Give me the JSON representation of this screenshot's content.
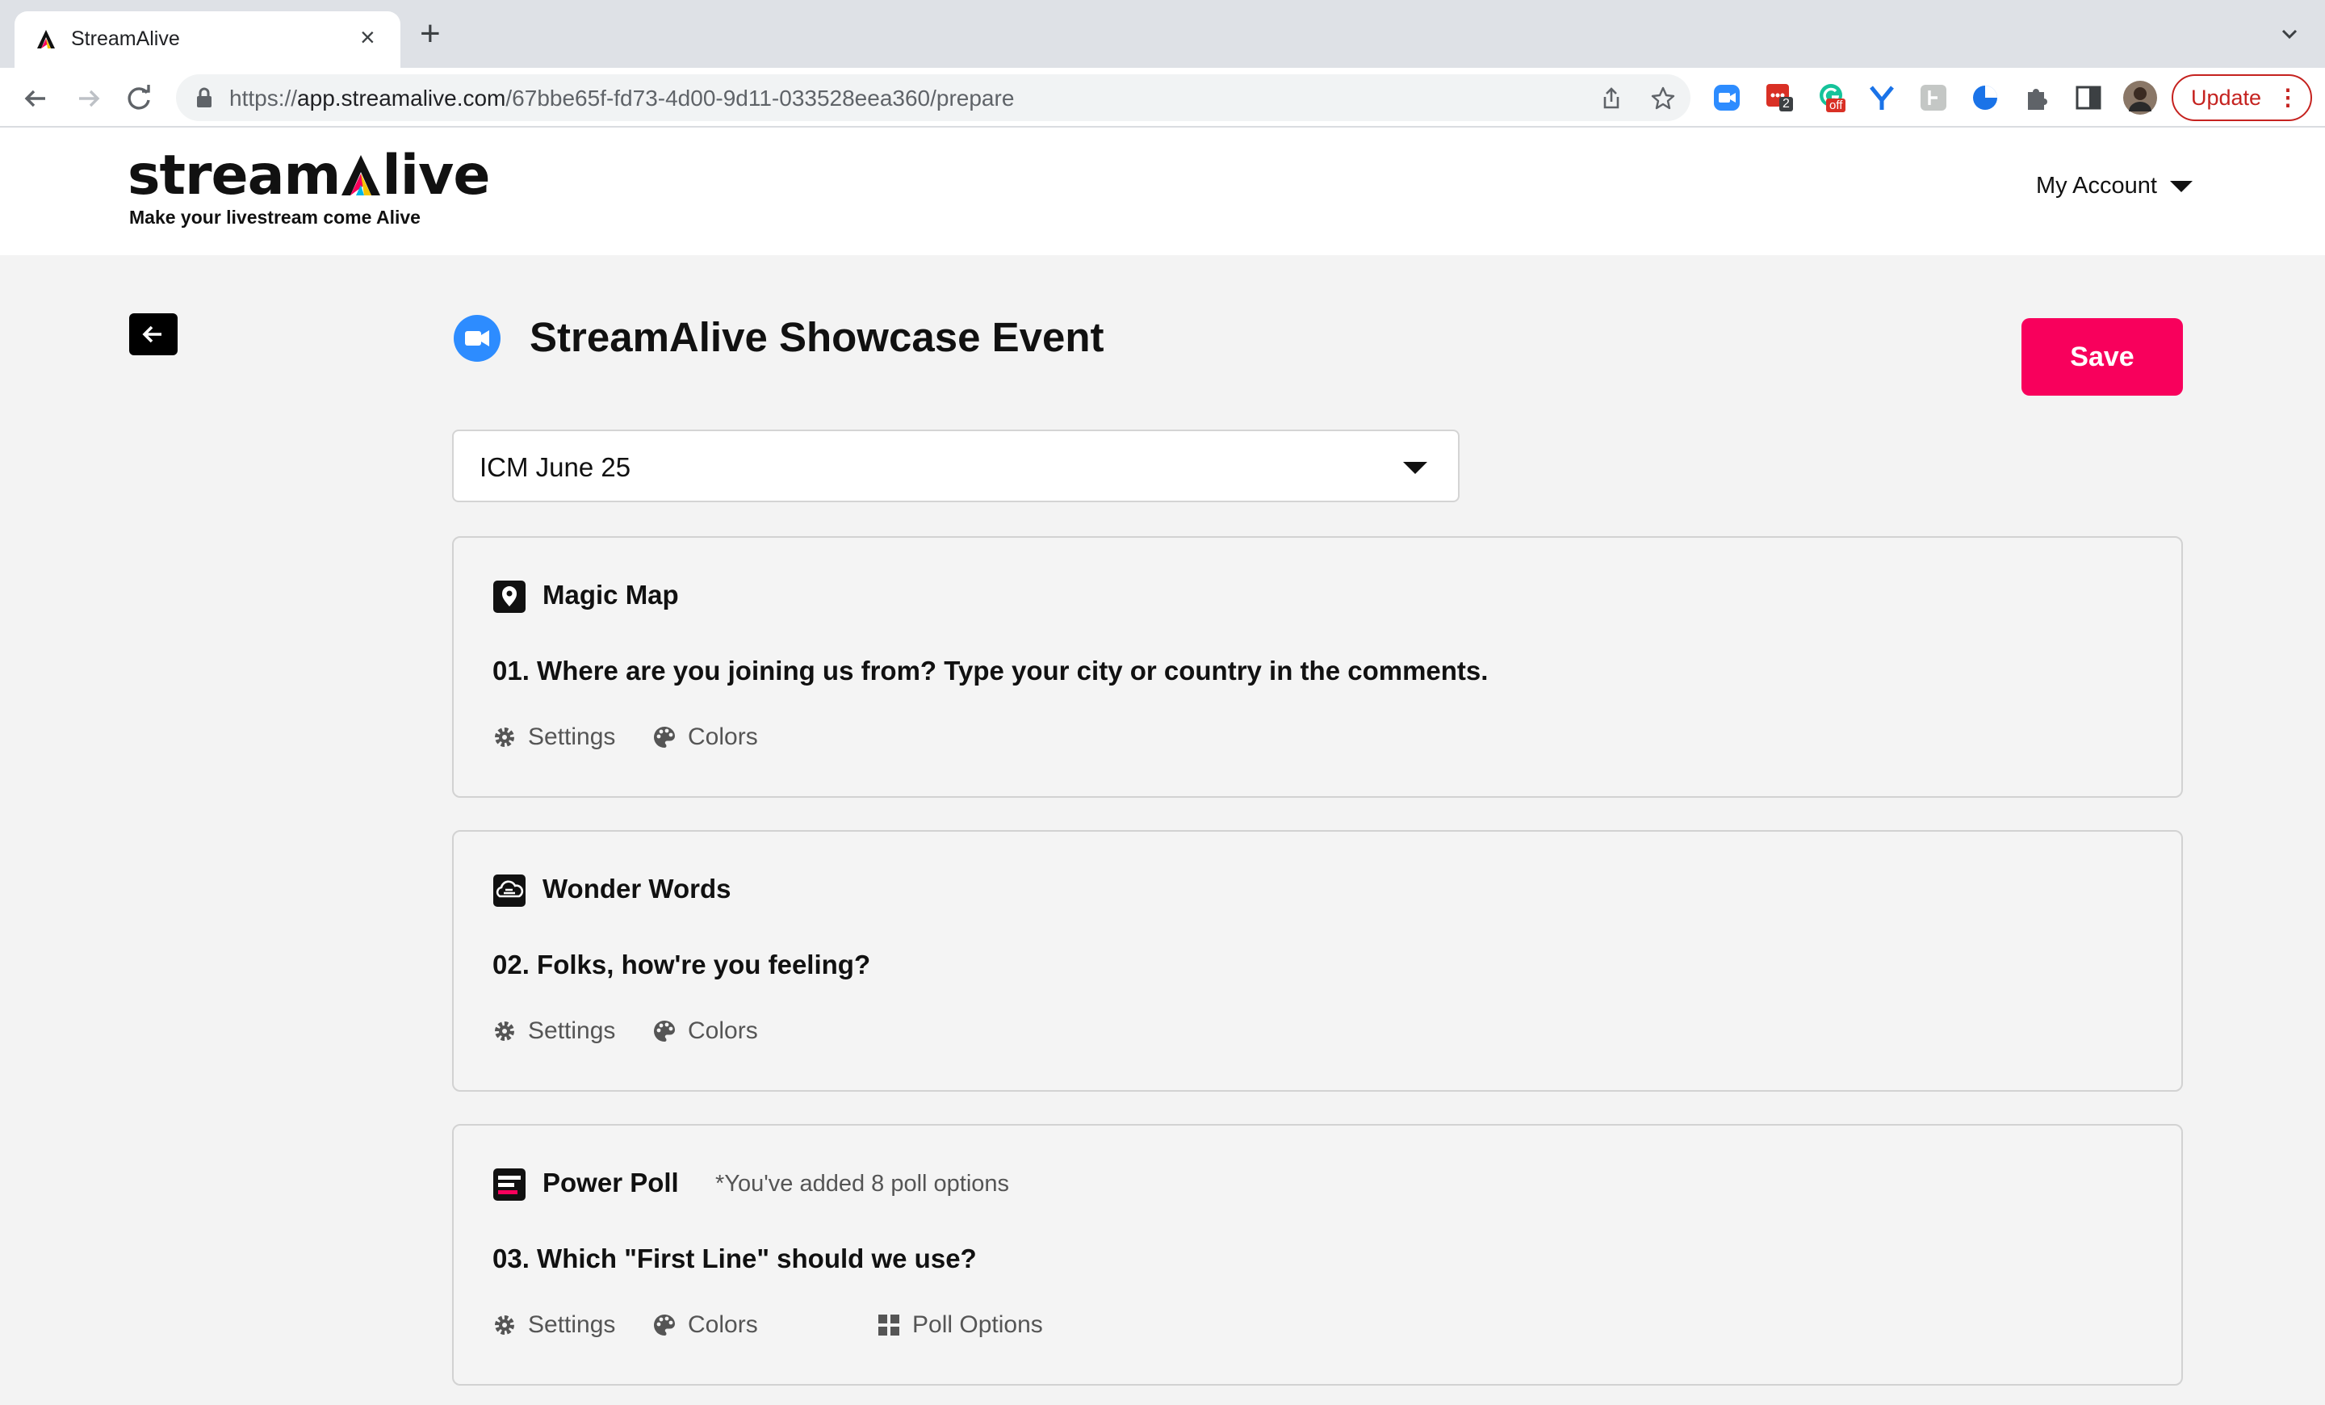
{
  "browser": {
    "tab_title": "StreamAlive",
    "tab_close": "×",
    "new_tab": "+",
    "url_scheme": "https://",
    "url_host": "app.streamalive.com",
    "url_path": "/67bbe65f-fd73-4d00-9d11-033528eea360/prepare",
    "extension_badges": {
      "ext_red": "2",
      "ext_green": "off"
    },
    "update_label": "Update",
    "update_menu": "⋮",
    "accent_color": "#c5221f"
  },
  "app": {
    "logo_text_start": "stream",
    "logo_text_end": "live",
    "tagline": "Make your livestream come Alive",
    "account_label": "My Account",
    "brand_color": "#f8005c"
  },
  "event": {
    "title": "StreamAlive Showcase Event",
    "save_label": "Save",
    "selected_session": "ICM June 25"
  },
  "cards": [
    {
      "type": "Magic Map",
      "question": "01. Where are you joining us from? Type your city or country in the comments.",
      "actions": [
        "Settings",
        "Colors"
      ]
    },
    {
      "type": "Wonder Words",
      "question": "02. Folks, how're you feeling?",
      "actions": [
        "Settings",
        "Colors"
      ]
    },
    {
      "type": "Power Poll",
      "note": "*You've added 8 poll options",
      "question": "03. Which \"First Line\" should we use?",
      "actions": [
        "Settings",
        "Colors",
        "Poll Options"
      ]
    }
  ]
}
